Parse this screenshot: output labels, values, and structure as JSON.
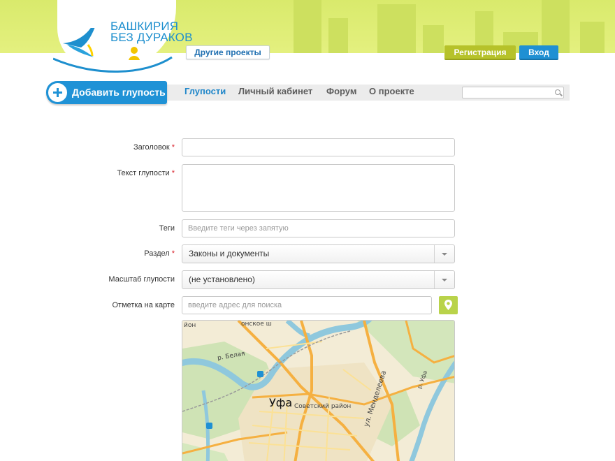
{
  "header": {
    "logo_line1": "БАШКИРИЯ",
    "logo_line2": "БЕЗ ДУРАКОВ",
    "other_projects": "Другие проекты",
    "register": "Регистрация",
    "login": "Вход"
  },
  "nav": {
    "add_button": "Добавить глупость",
    "items": [
      {
        "label": "Глупости",
        "active": true
      },
      {
        "label": "Личный кабинет",
        "active": false
      },
      {
        "label": "Форум",
        "active": false
      },
      {
        "label": "О проекте",
        "active": false
      }
    ],
    "search_value": ""
  },
  "form": {
    "required_mark": "*",
    "title_label": "Заголовок",
    "title_value": "",
    "text_label": "Текст глупости",
    "text_value": "",
    "tags_label": "Теги",
    "tags_placeholder": "Введите теги через запятую",
    "section_label": "Раздел",
    "section_value": "Законы и документы",
    "scale_label": "Масштаб глупости",
    "scale_value": "(не установлено)",
    "map_label": "Отметка на карте",
    "address_placeholder": "введите адрес для поиска"
  },
  "map": {
    "city": "Уфа",
    "district": "Советский район",
    "river": "р. Белая",
    "river_ufa": "р. Уфа",
    "street": "ул. Менделеева",
    "partial_top": "йон",
    "partial_top2": "онское ш"
  },
  "colors": {
    "brand_blue": "#1f90d3",
    "brand_green": "#b6c22a",
    "banner": "#dcec72",
    "map_road": "#f5b041",
    "map_water": "#8fc8dd"
  }
}
